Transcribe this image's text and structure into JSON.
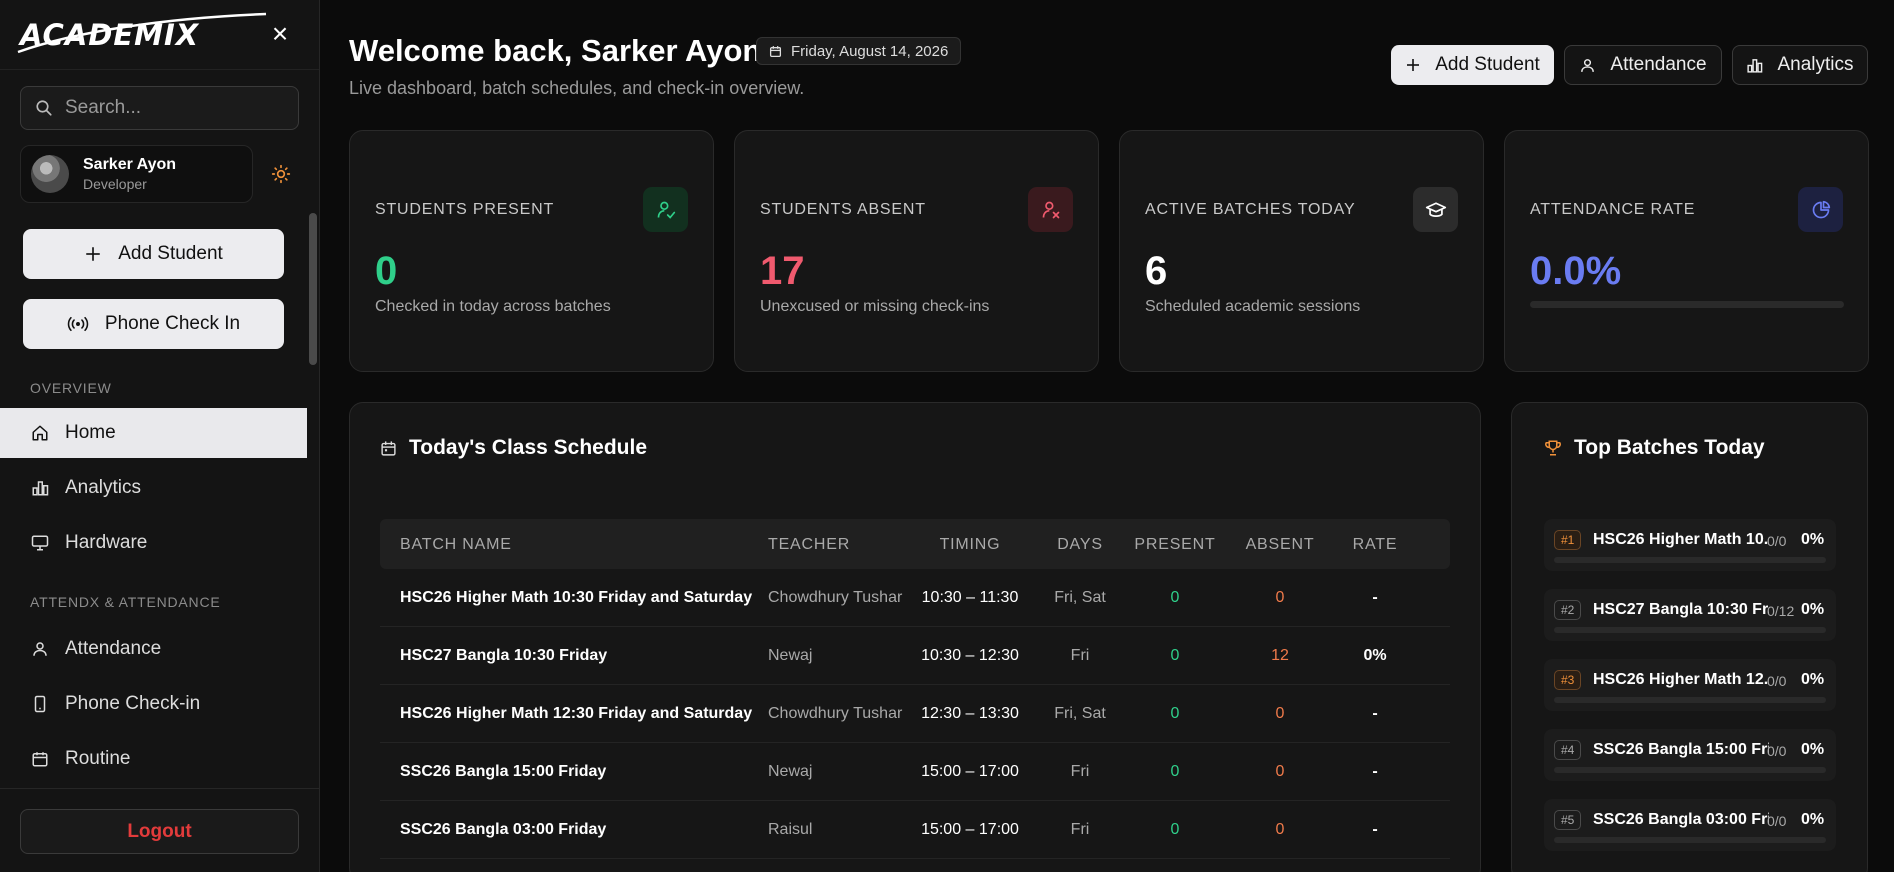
{
  "sidebar": {
    "logo": "ACADEMIX",
    "search_placeholder": "Search...",
    "profile": {
      "name": "Sarker Ayon",
      "role": "Developer"
    },
    "add_student": "Add Student",
    "phone_check_in": "Phone Check In",
    "sections": {
      "overview": "OVERVIEW",
      "attendance": "ATTENDX & ATTENDANCE"
    },
    "overview_items": [
      {
        "label": "Home",
        "icon": "home-icon",
        "active": true
      },
      {
        "label": "Analytics",
        "icon": "chart-icon",
        "active": false
      },
      {
        "label": "Hardware",
        "icon": "monitor-icon",
        "active": false
      }
    ],
    "attendance_items": [
      {
        "label": "Attendance",
        "icon": "user-icon"
      },
      {
        "label": "Phone Check-in",
        "icon": "phone-icon"
      },
      {
        "label": "Routine",
        "icon": "calendar-icon"
      }
    ],
    "logout": "Logout"
  },
  "header": {
    "title": "Welcome back, Sarker Ayon",
    "date": "Friday, August 14, 2026",
    "subtitle": "Live dashboard, batch schedules, and check-in overview.",
    "buttons": {
      "add_student": "Add Student",
      "attendance": "Attendance",
      "analytics": "Analytics"
    }
  },
  "stats": [
    {
      "label": "STUDENTS PRESENT",
      "value": "0",
      "desc": "Checked in today across batches",
      "color": "#2fcf8a",
      "icon": "user-check-icon"
    },
    {
      "label": "STUDENTS ABSENT",
      "value": "17",
      "desc": "Unexcused or missing check-ins",
      "color": "#f05a6e",
      "icon": "user-x-icon"
    },
    {
      "label": "ACTIVE BATCHES TODAY",
      "value": "6",
      "desc": "Scheduled academic sessions",
      "color": "#ffffff",
      "icon": "graduation-cap-icon"
    },
    {
      "label": "ATTENDANCE RATE",
      "value": "0.0%",
      "desc": "",
      "color": "#6a7cf2",
      "icon": "pie-chart-icon",
      "progress": 0.0
    }
  ],
  "schedule": {
    "title": "Today's Class Schedule",
    "columns": [
      "BATCH NAME",
      "TEACHER",
      "TIMING",
      "DAYS",
      "PRESENT",
      "ABSENT",
      "RATE"
    ],
    "rows": [
      {
        "name": "HSC26 Higher Math 10:30 Friday and Saturday",
        "teacher": "Chowdhury Tushar",
        "timing": "10:30 – 11:30",
        "days": "Fri, Sat",
        "present": "0",
        "absent": "0",
        "rate": "-"
      },
      {
        "name": "HSC27 Bangla 10:30 Friday",
        "teacher": "Newaj",
        "timing": "10:30 – 12:30",
        "days": "Fri",
        "present": "0",
        "absent": "12",
        "rate": "0%"
      },
      {
        "name": "HSC26 Higher Math 12:30 Friday and Saturday",
        "teacher": "Chowdhury Tushar",
        "timing": "12:30 – 13:30",
        "days": "Fri, Sat",
        "present": "0",
        "absent": "0",
        "rate": "-"
      },
      {
        "name": "SSC26 Bangla 15:00 Friday",
        "teacher": "Newaj",
        "timing": "15:00 – 17:00",
        "days": "Fri",
        "present": "0",
        "absent": "0",
        "rate": "-"
      },
      {
        "name": "SSC26 Bangla 03:00 Friday",
        "teacher": "Raisul",
        "timing": "15:00 – 17:00",
        "days": "Fri",
        "present": "0",
        "absent": "0",
        "rate": "-"
      }
    ]
  },
  "top_batches": {
    "title": "Top Batches Today",
    "items": [
      {
        "rank": "#1",
        "name": "HSC26 Higher Math 10...",
        "ratio": "0/0",
        "pct": "0%"
      },
      {
        "rank": "#2",
        "name": "HSC27 Bangla 10:30 Fr...",
        "ratio": "0/12",
        "pct": "0%"
      },
      {
        "rank": "#3",
        "name": "HSC26 Higher Math 12...",
        "ratio": "0/0",
        "pct": "0%"
      },
      {
        "rank": "#4",
        "name": "SSC26 Bangla 15:00 Fri...",
        "ratio": "0/0",
        "pct": "0%"
      },
      {
        "rank": "#5",
        "name": "SSC26 Bangla 03:00 Fri...",
        "ratio": "0/0",
        "pct": "0%"
      }
    ]
  },
  "colors": {
    "accent_green": "#2fcf8a",
    "accent_red": "#f05a6e",
    "accent_orange": "#ef7a4a",
    "accent_indigo": "#6a7cf2",
    "logout_red": "#e23b3b"
  }
}
